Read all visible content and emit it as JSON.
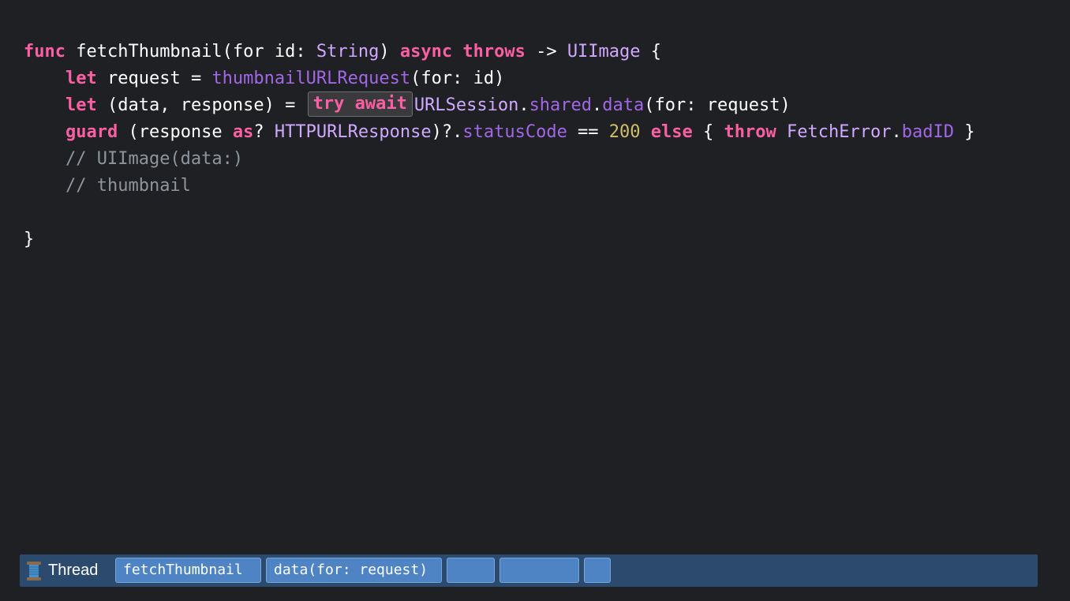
{
  "code": {
    "line1": {
      "func": "func",
      "name": " fetchThumbnail(for id: ",
      "string_type": "String",
      "close": ") ",
      "async": "async",
      "throws": "throws",
      "arrow": " -> ",
      "return_type": "UIImage",
      "brace": " {"
    },
    "line2": {
      "let": "let",
      "assign": " request = ",
      "call": "thumbnailURLRequest",
      "args": "(for: id)"
    },
    "line3": {
      "let": "let",
      "assign": " (data, response) = ",
      "try_await": "try await",
      "session": "URLSession",
      "dot1": ".",
      "shared": "shared",
      "dot2": ".",
      "data_fn": "data",
      "args": "(for: request)"
    },
    "line4": {
      "guard": "guard",
      "open": " (response ",
      "as": "as",
      "q": "? ",
      "http_type": "HTTPURLResponse",
      "chain": ")?.",
      "status_code": "statusCode",
      "eq": " == ",
      "number": "200",
      "space1": " ",
      "else": "else",
      "brace_open": " { ",
      "throw": "throw",
      "space2": " ",
      "error_type": "FetchError",
      "dot": ".",
      "case": "badID",
      "brace_close": " }"
    },
    "line5": {
      "comment": "// UIImage(data:)"
    },
    "line6": {
      "comment": "// thumbnail"
    },
    "line8": {
      "brace": "}"
    }
  },
  "thread_bar": {
    "label": "Thread",
    "icon": "spool-of-thread-icon",
    "frames": [
      "fetchThumbnail",
      "data(for: request)",
      "",
      "",
      ""
    ]
  },
  "colors": {
    "background": "#1f2023",
    "keyword": "#fc5fa3",
    "type": "#d0a8ff",
    "function": "#a167e6",
    "number": "#d0bf69",
    "comment": "#8e959d",
    "thread_bar": "#2b4a6e",
    "frame": "#4f84c4"
  }
}
